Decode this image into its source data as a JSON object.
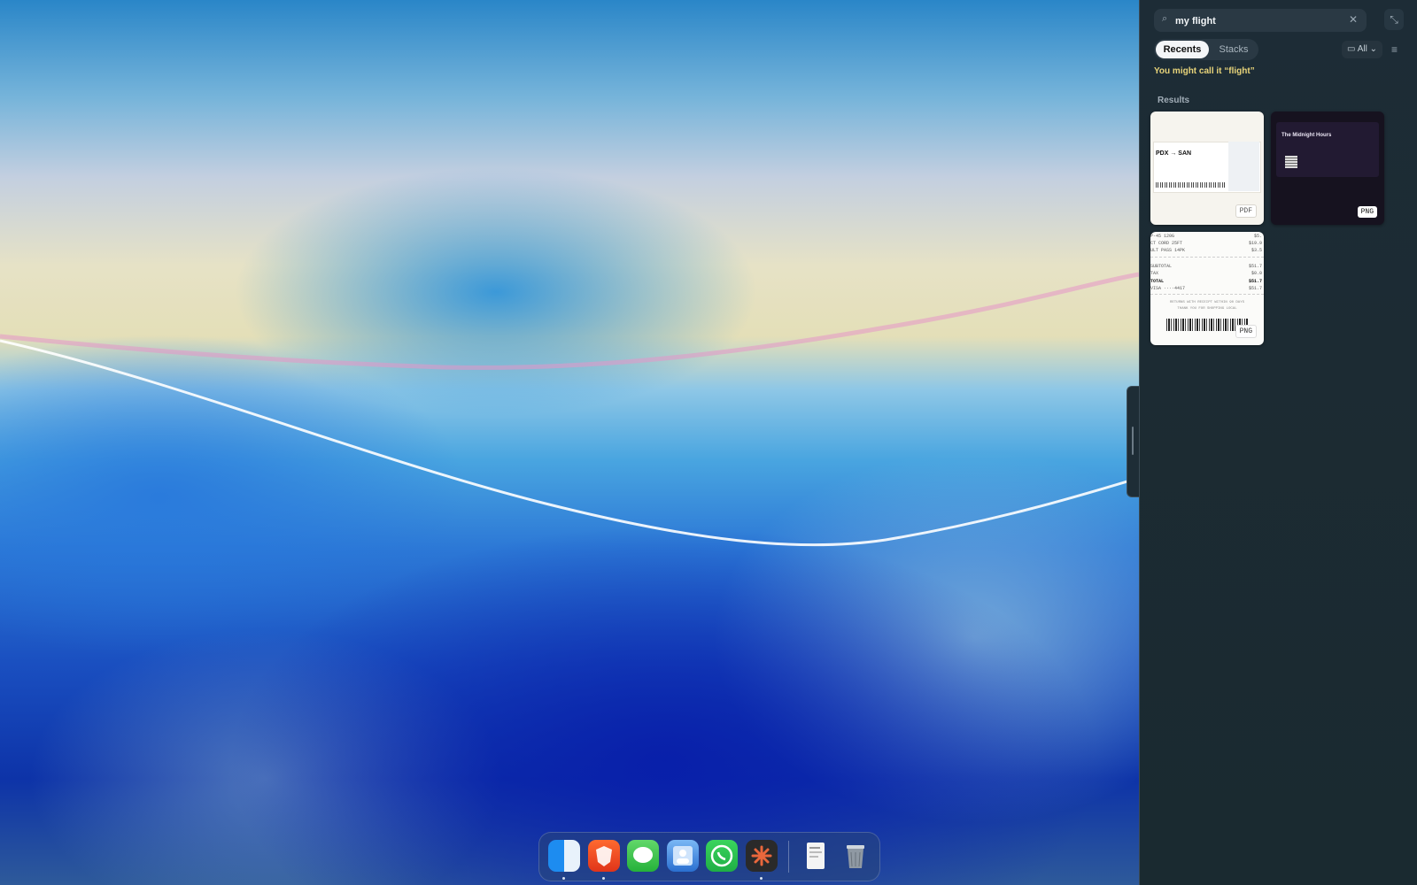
{
  "panel": {
    "search": {
      "value": "my flight",
      "search_icon": "⌕",
      "clear_icon": "✕"
    },
    "expand_icon": "⤡",
    "tabs": [
      {
        "label": "Recents",
        "active": true
      },
      {
        "label": "Stacks",
        "active": false
      }
    ],
    "filter": {
      "label": "All"
    },
    "menu_icon": "≡",
    "suggestion": "You might call it “flight”",
    "results_label": "Results",
    "results": [
      {
        "kind": "boarding-pass",
        "badge": "PDF",
        "route": "PDX → SAN"
      },
      {
        "kind": "event-ticket",
        "badge": "PNG",
        "title": "The Midnight Hours"
      },
      {
        "kind": "receipt",
        "badge": "PNG",
        "lines": [
          {
            "label": "P-45 120G",
            "amount": "$5."
          },
          {
            "label": "CT CORD 25FT",
            "amount": "$19.9"
          },
          {
            "label": "ULT PASS 14PK",
            "amount": "$3.5"
          },
          {
            "label": "SUBTOTAL",
            "amount": "$51.7"
          },
          {
            "label": "TAX",
            "amount": "$0.0"
          },
          {
            "label": "TOTAL",
            "amount": "$51.7"
          },
          {
            "label": "VISA ····4417",
            "amount": "$51.7"
          }
        ],
        "footer": [
          "RETURNS WITH RECEIPT WITHIN 90 DAYS",
          "THANK YOU FOR SHOPPING LOCAL"
        ]
      }
    ]
  },
  "dock": {
    "apps": [
      {
        "name": "Finder",
        "icon": "finder-icon",
        "running": true
      },
      {
        "name": "Brave",
        "icon": "brave-icon",
        "running": true
      },
      {
        "name": "Messages",
        "icon": "messages-icon",
        "running": false
      },
      {
        "name": "Preview",
        "icon": "preview-icon",
        "running": false
      },
      {
        "name": "WhatsApp",
        "icon": "whatsapp-icon",
        "running": false
      },
      {
        "name": "Claude",
        "icon": "claude-icon",
        "running": true
      },
      {
        "name": "Documents",
        "icon": "documents-stack-icon",
        "running": false
      },
      {
        "name": "Trash",
        "icon": "trash-icon",
        "running": false
      }
    ]
  },
  "colors": {
    "suggestion": "#e8d47a",
    "panel_bg": "#1c2b33"
  }
}
